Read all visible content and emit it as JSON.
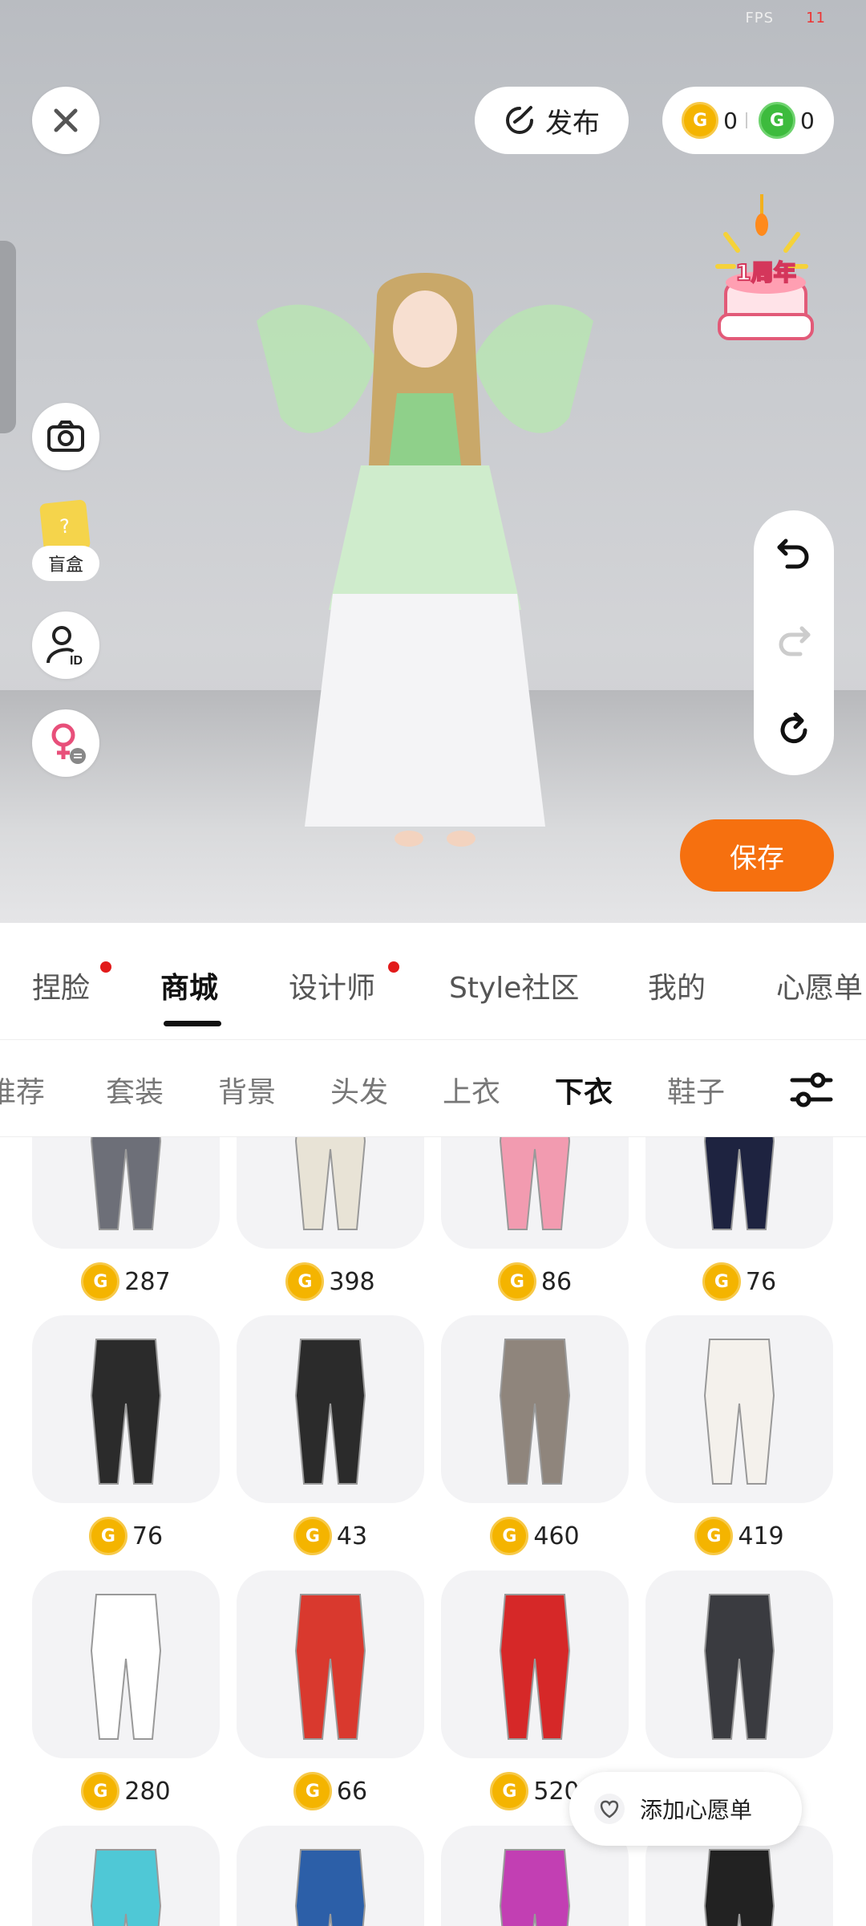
{
  "status": {
    "fps_label": "FPS",
    "fps_value": "11"
  },
  "top_bar": {
    "publish_label": "发布",
    "coins": [
      {
        "type": "gold",
        "value": "0"
      },
      {
        "type": "green",
        "value": "0"
      }
    ],
    "anniversary_label": "1周年"
  },
  "left_tools": {
    "blind_box_label": "盲盒"
  },
  "save_label": "保存",
  "main_tabs": [
    {
      "label": "捏脸",
      "dot": true
    },
    {
      "label": "商城",
      "active": true
    },
    {
      "label": "设计师",
      "dot": true
    },
    {
      "label": "Style社区"
    },
    {
      "label": "我的"
    },
    {
      "label": "心愿单"
    }
  ],
  "categories": [
    "推荐",
    "套装",
    "背景",
    "头发",
    "上衣",
    "下衣",
    "鞋子"
  ],
  "active_category": "下衣",
  "items": [
    {
      "price": "287",
      "color": "#6d6f78"
    },
    {
      "price": "398",
      "color": "#e8e3d6"
    },
    {
      "price": "86",
      "color": "#f29bb0"
    },
    {
      "price": "76",
      "color": "#1e2340"
    },
    {
      "price": "76",
      "color": "#2b2b2b"
    },
    {
      "price": "43",
      "color": "#2b2b2b"
    },
    {
      "price": "460",
      "color": "#8f857c"
    },
    {
      "price": "419",
      "color": "#f4f1ec"
    },
    {
      "price": "280",
      "color": "#ffffff"
    },
    {
      "price": "66",
      "color": "#d9392e"
    },
    {
      "price": "520",
      "color": "#d62828"
    },
    {
      "price": "",
      "color": "#3a3b40"
    },
    {
      "price": "",
      "color": "#4fc8d6"
    },
    {
      "price": "",
      "color": "#2c5fa8"
    },
    {
      "price": "",
      "color": "#c23fb3"
    },
    {
      "price": "",
      "color": "#222222"
    }
  ],
  "wishlist_label": "添加心愿单",
  "coin_glyph": "G"
}
